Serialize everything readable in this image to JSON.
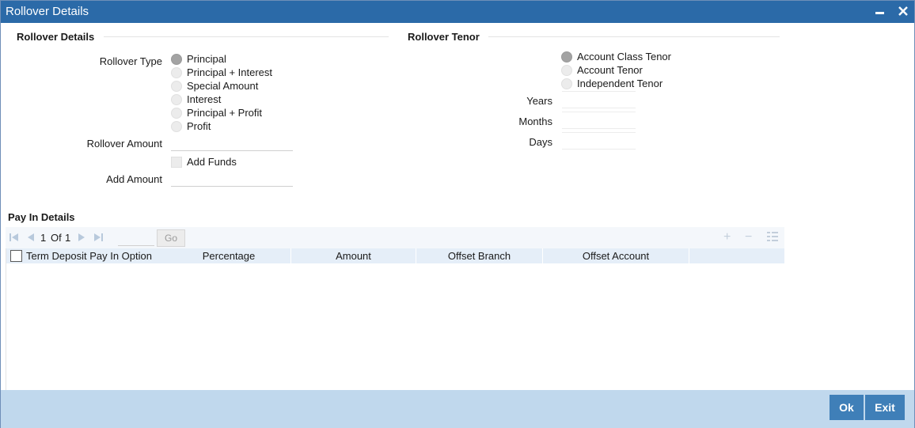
{
  "window": {
    "title": "Rollover Details"
  },
  "rollover_details": {
    "section_title": "Rollover Details",
    "rollover_type_label": "Rollover Type",
    "rollover_types": [
      {
        "label": "Principal",
        "checked": true
      },
      {
        "label": "Principal + Interest",
        "checked": false
      },
      {
        "label": "Special Amount",
        "checked": false
      },
      {
        "label": "Interest",
        "checked": false
      },
      {
        "label": "Principal + Profit",
        "checked": false
      },
      {
        "label": "Profit",
        "checked": false
      }
    ],
    "rollover_amount_label": "Rollover Amount",
    "rollover_amount_value": "",
    "add_funds_label": "Add Funds",
    "add_funds_checked": false,
    "add_amount_label": "Add Amount",
    "add_amount_value": ""
  },
  "rollover_tenor": {
    "section_title": "Rollover Tenor",
    "options": [
      {
        "label": "Account Class Tenor",
        "checked": true
      },
      {
        "label": "Account Tenor",
        "checked": false
      },
      {
        "label": "Independent Tenor",
        "checked": false
      }
    ],
    "years_label": "Years",
    "years_value": "",
    "months_label": "Months",
    "months_value": "",
    "days_label": "Days",
    "days_value": ""
  },
  "pay_in": {
    "section_title": "Pay In Details",
    "pagination": {
      "current": "1",
      "of_label": "Of",
      "total": "1",
      "go_label": "Go"
    },
    "columns": [
      "Term Deposit Pay In Option",
      "Percentage",
      "Amount",
      "Offset Branch",
      "Offset Account"
    ],
    "rows": []
  },
  "footer": {
    "ok_label": "Ok",
    "exit_label": "Exit"
  },
  "colors": {
    "titlebar": "#2b6aa8",
    "footer": "#c0d8ed",
    "button": "#3f7fb8"
  }
}
